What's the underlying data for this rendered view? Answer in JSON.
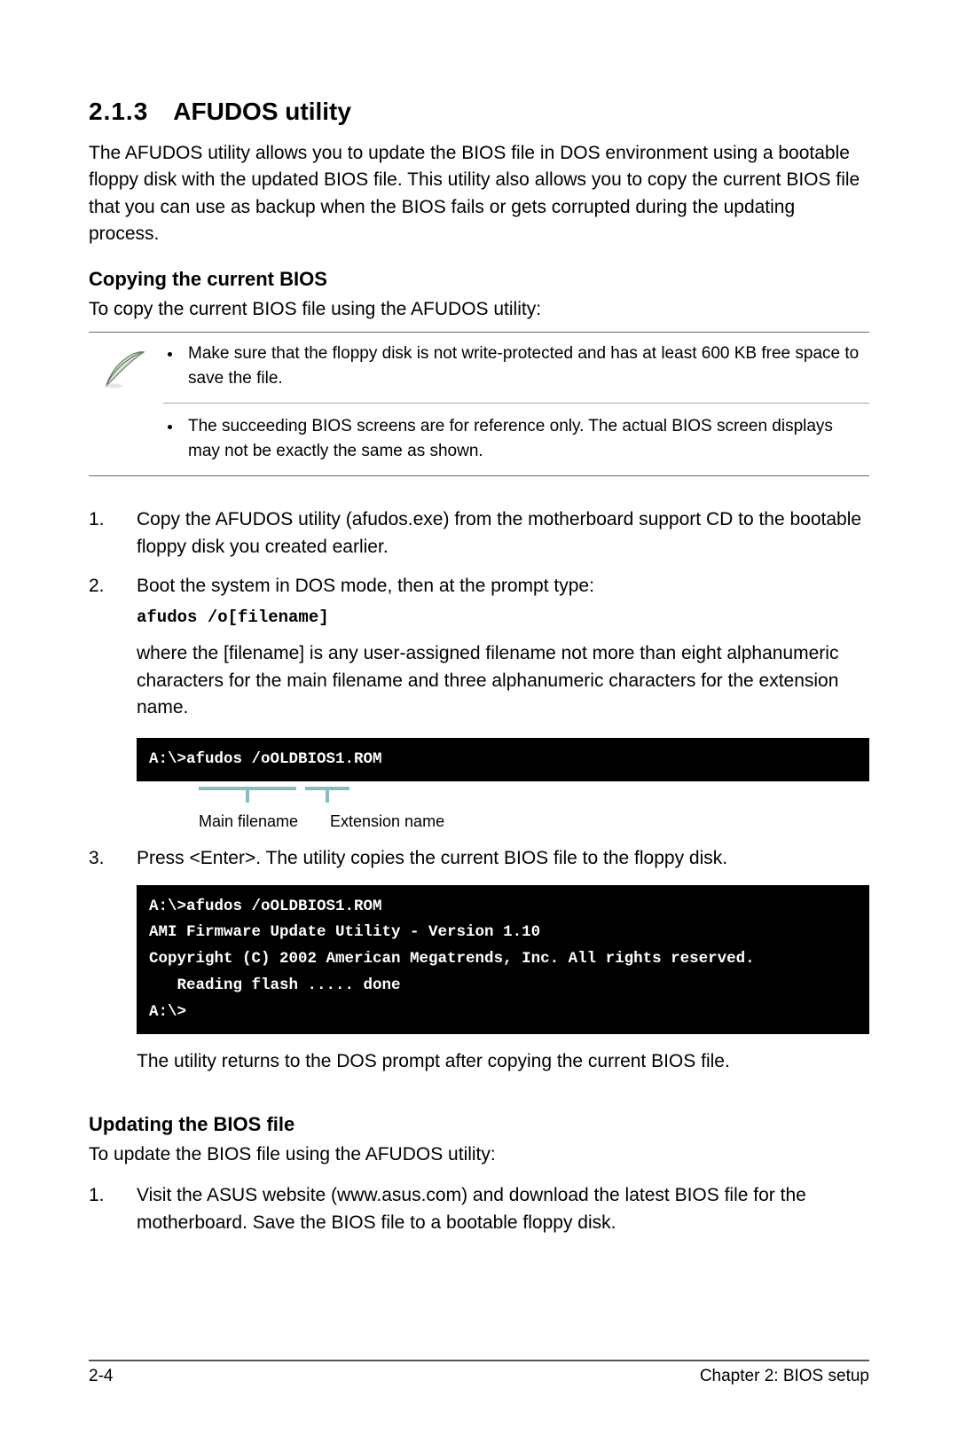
{
  "section": {
    "number": "2.1.3",
    "title": "AFUDOS utility"
  },
  "intro": "The AFUDOS utility allows you to update the BIOS file in DOS environment using a bootable floppy disk with the updated BIOS file. This utility also allows you to copy the current BIOS file that you can use as backup when the BIOS fails or gets corrupted during the updating process.",
  "copying": {
    "heading": "Copying the current BIOS",
    "lead": "To copy the current BIOS file using the AFUDOS utility:"
  },
  "notes": [
    "Make sure that the floppy disk is not write-protected and has at least 600 KB free space to save the file.",
    "The succeeding BIOS screens are for reference only. The actual BIOS screen displays may not be exactly the same as shown."
  ],
  "steps_a": [
    {
      "num": "1.",
      "text": "Copy the AFUDOS utility (afudos.exe) from the motherboard support CD to the bootable floppy disk you created earlier."
    },
    {
      "num": "2.",
      "text": "Boot the system in DOS mode, then at the prompt type:",
      "cmd": "afudos /o[filename]",
      "after": "where the [filename] is any user-assigned filename not more than eight alphanumeric characters  for the main filename and three alphanumeric characters for the extension name."
    }
  ],
  "terminal1": "A:\\>afudos /oOLDBIOS1.ROM",
  "callouts": {
    "main": "Main filename",
    "ext": "Extension name"
  },
  "steps_b": [
    {
      "num": "3.",
      "text": "Press <Enter>. The utility copies the current BIOS file to the floppy disk."
    }
  ],
  "terminal2": "A:\\>afudos /oOLDBIOS1.ROM\nAMI Firmware Update Utility - Version 1.10\nCopyright (C) 2002 American Megatrends, Inc. All rights reserved.\n   Reading flash ..... done\nA:\\>",
  "after_terminal2": "The utility returns to the DOS prompt after copying the current BIOS file.",
  "updating": {
    "heading": "Updating the BIOS file",
    "lead": "To update the BIOS file using the AFUDOS utility:"
  },
  "steps_c": [
    {
      "num": "1.",
      "text": "Visit the ASUS website (www.asus.com) and download the latest BIOS file for the motherboard. Save the BIOS file to a bootable floppy disk."
    }
  ],
  "footer": {
    "left": "2-4",
    "right": "Chapter 2: BIOS setup"
  },
  "icon_name": "feather-pen-icon"
}
